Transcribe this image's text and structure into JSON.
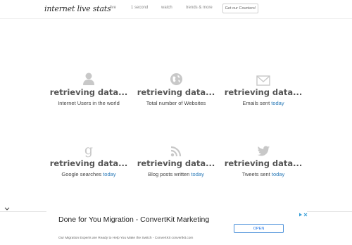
{
  "header": {
    "logo": "internet live stats",
    "nav": [
      "live",
      "1 second",
      "watch",
      "trends & more"
    ],
    "cta": "Get our Counters!"
  },
  "stats": [
    {
      "value": "retrieving data...",
      "label": "Internet Users in the world",
      "today": "",
      "icon": "user-icon"
    },
    {
      "value": "retrieving data...",
      "label": "Total number of Websites",
      "today": "",
      "icon": "globe-icon"
    },
    {
      "value": "retrieving data...",
      "label": "Emails sent",
      "today": "today",
      "icon": "envelope-icon"
    },
    {
      "value": "retrieving data...",
      "label": "Google searches",
      "today": "today",
      "icon": "google-icon"
    },
    {
      "value": "retrieving data...",
      "label": "Blog posts written",
      "today": "today",
      "icon": "rss-icon"
    },
    {
      "value": "retrieving data...",
      "label": "Tweets sent",
      "today": "today",
      "icon": "twitter-bird-icon"
    }
  ],
  "ad": {
    "title": "Done for You Migration - ConvertKit Marketing",
    "subtitle": "Our Migration Experts are Ready to Help You Make the Switch - ConvertKit convertkit.com",
    "button": "OPEN"
  },
  "colors": {
    "today_link": "#2a7ab8",
    "icon_gray": "#c8c8c8",
    "open_border": "#4a90d9"
  }
}
